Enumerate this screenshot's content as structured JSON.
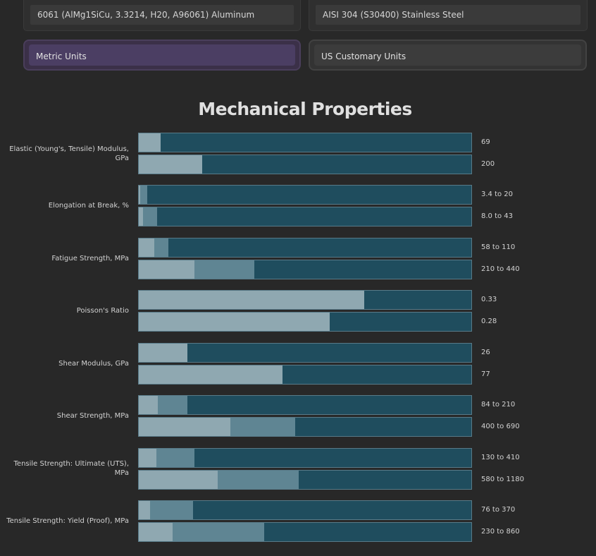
{
  "materials": [
    "6061 (AlMg1SiCu, 3.3214, H20, A96061) Aluminum",
    "AISI 304 (S30400) Stainless Steel"
  ],
  "units": {
    "metric": "Metric Units",
    "us": "US Customary Units",
    "selected": "Metric Units"
  },
  "section_title": "Mechanical Properties",
  "colors": {
    "background": "#282828",
    "bar_track": "#1f4d5e",
    "bar_range": "#5f8593",
    "bar_min": "#8fa8b1",
    "selected_unit": "#4b3e63"
  },
  "properties": [
    {
      "label": "Elastic (Young's, Tensile) Modulus, GPa",
      "rows": [
        {
          "text": "69",
          "min_frac": 0.065,
          "max_frac": 0.065
        },
        {
          "text": "200",
          "min_frac": 0.19,
          "max_frac": 0.19
        }
      ]
    },
    {
      "label": "Elongation at Break, %",
      "rows": [
        {
          "text": "3.4 to 20",
          "min_frac": 0.005,
          "max_frac": 0.026
        },
        {
          "text": "8.0 to 43",
          "min_frac": 0.012,
          "max_frac": 0.055
        }
      ]
    },
    {
      "label": "Fatigue Strength, MPa",
      "rows": [
        {
          "text": "58 to 110",
          "min_frac": 0.047,
          "max_frac": 0.088
        },
        {
          "text": "210 to 440",
          "min_frac": 0.166,
          "max_frac": 0.346
        }
      ]
    },
    {
      "label": "Poisson's Ratio",
      "rows": [
        {
          "text": "0.33",
          "min_frac": 0.676,
          "max_frac": 0.676
        },
        {
          "text": "0.28",
          "min_frac": 0.572,
          "max_frac": 0.572
        }
      ]
    },
    {
      "label": "Shear Modulus, GPa",
      "rows": [
        {
          "text": "26",
          "min_frac": 0.146,
          "max_frac": 0.146
        },
        {
          "text": "77",
          "min_frac": 0.43,
          "max_frac": 0.43
        }
      ]
    },
    {
      "label": "Shear Strength, MPa",
      "rows": [
        {
          "text": "84 to 210",
          "min_frac": 0.057,
          "max_frac": 0.146
        },
        {
          "text": "400 to 690",
          "min_frac": 0.274,
          "max_frac": 0.469
        }
      ]
    },
    {
      "label": "Tensile Strength: Ultimate (UTS), MPa",
      "rows": [
        {
          "text": "130 to 410",
          "min_frac": 0.053,
          "max_frac": 0.167
        },
        {
          "text": "580 to 1180",
          "min_frac": 0.236,
          "max_frac": 0.479
        }
      ]
    },
    {
      "label": "Tensile Strength: Yield (Proof), MPa",
      "rows": [
        {
          "text": "76 to 370",
          "min_frac": 0.034,
          "max_frac": 0.162
        },
        {
          "text": "230 to 860",
          "min_frac": 0.101,
          "max_frac": 0.375
        }
      ]
    }
  ]
}
